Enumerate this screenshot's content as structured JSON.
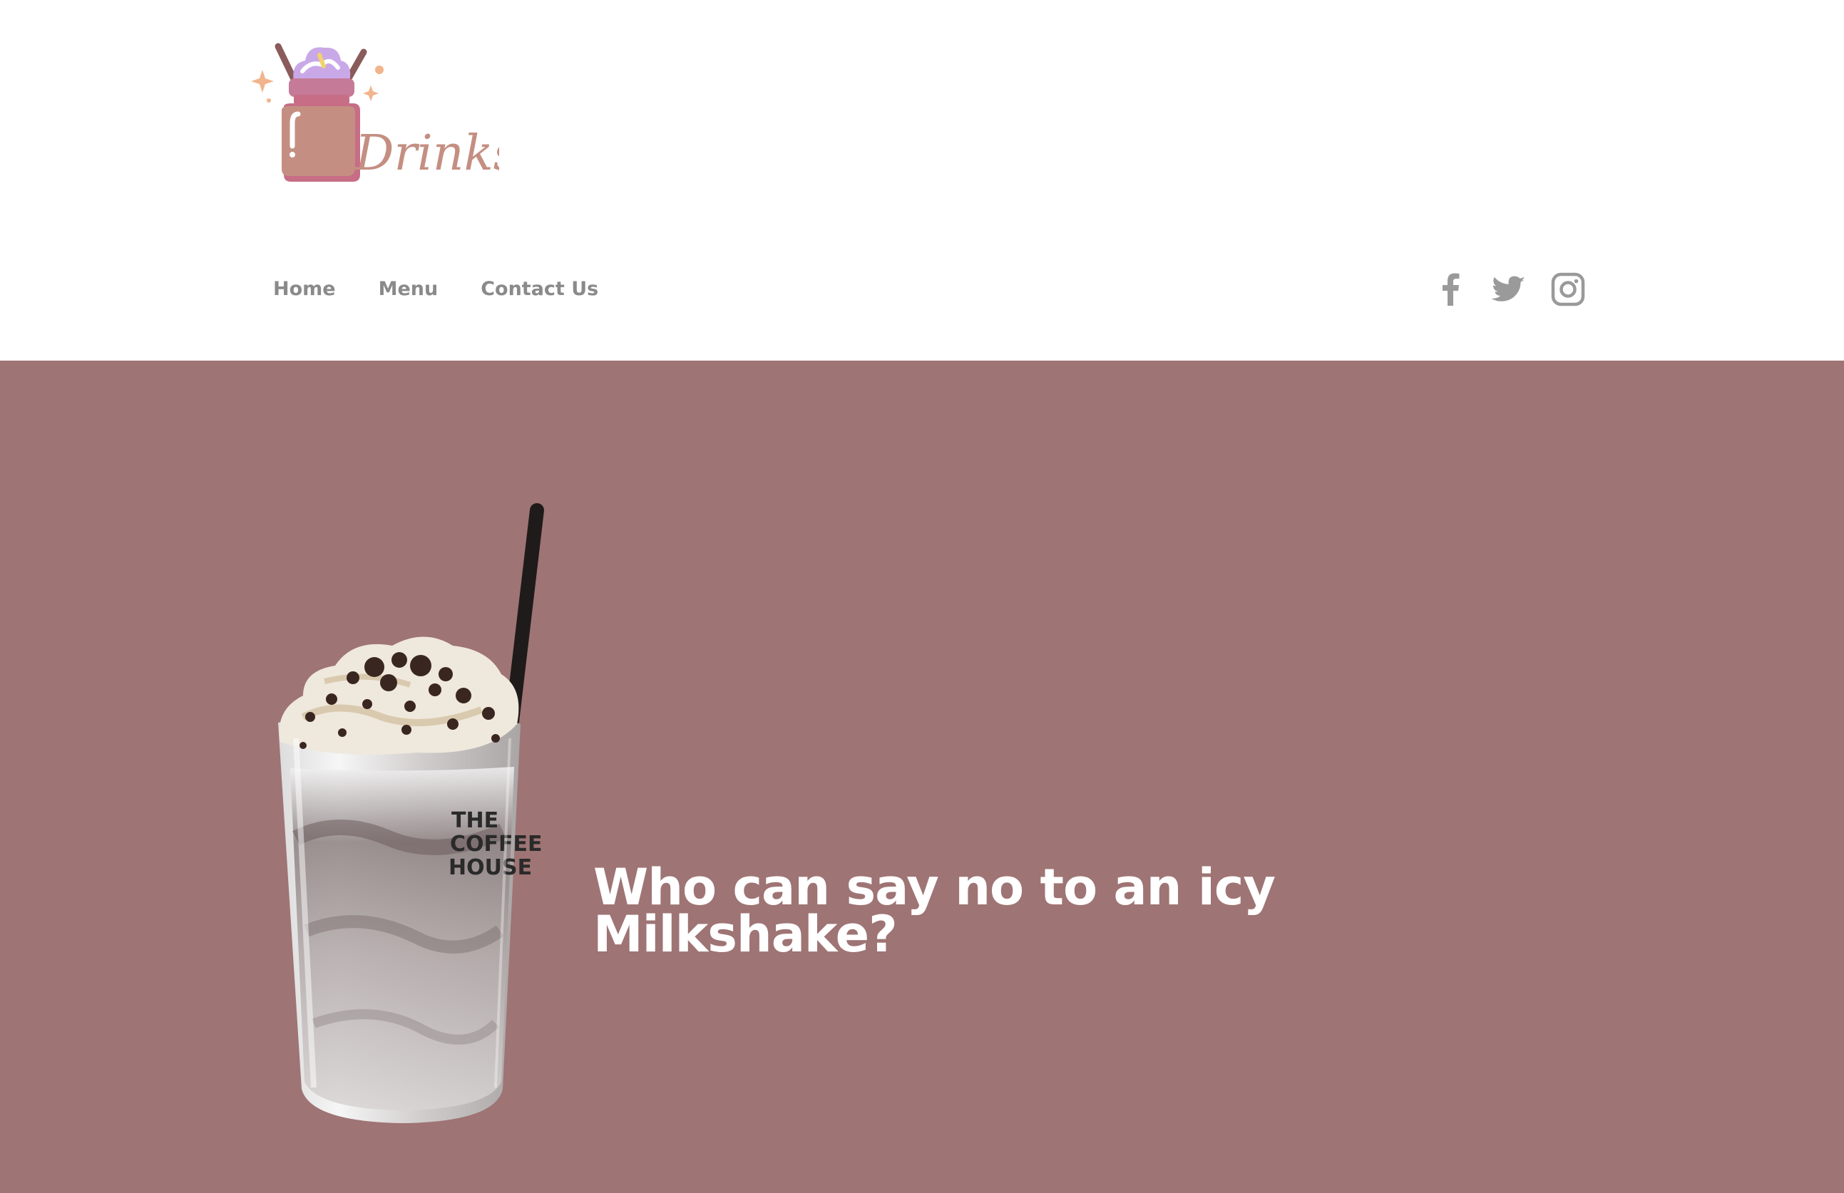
{
  "brand": {
    "logo_text": "Drinks",
    "colors": {
      "mug": "#c48f82",
      "mug_lid": "#c57a98",
      "cream": "#c9a8e8",
      "sparkle": "#f2b48c"
    }
  },
  "nav": {
    "items": [
      {
        "label": "Home"
      },
      {
        "label": "Menu"
      },
      {
        "label": "Contact Us"
      }
    ]
  },
  "social": {
    "icons": [
      "facebook-icon",
      "twitter-icon",
      "instagram-icon"
    ],
    "color": "#9a9a9a"
  },
  "hero": {
    "background": "#9f7474",
    "title": "Who can say no to an icy Milkshake?",
    "image": {
      "cup_text": [
        "THE",
        "COFFEE",
        "HOUSE"
      ]
    }
  }
}
